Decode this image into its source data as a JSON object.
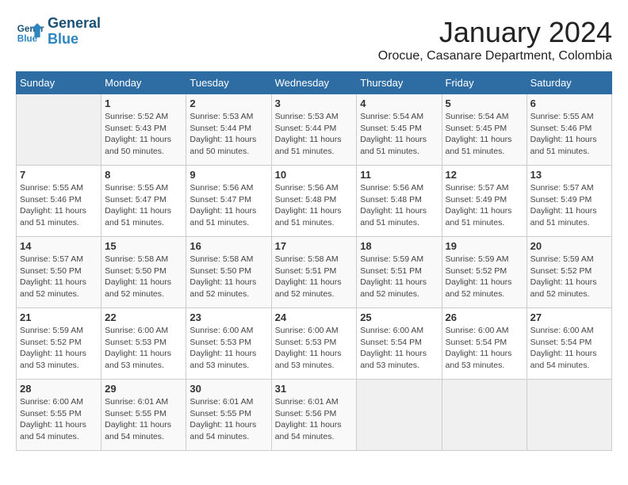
{
  "logo": {
    "text_line1": "General",
    "text_line2": "Blue"
  },
  "title": "January 2024",
  "location": "Orocue, Casanare Department, Colombia",
  "days_of_week": [
    "Sunday",
    "Monday",
    "Tuesday",
    "Wednesday",
    "Thursday",
    "Friday",
    "Saturday"
  ],
  "weeks": [
    [
      {
        "day": "",
        "sunrise": "",
        "sunset": "",
        "daylight": ""
      },
      {
        "day": "1",
        "sunrise": "5:52 AM",
        "sunset": "5:43 PM",
        "daylight": "11 hours and 50 minutes."
      },
      {
        "day": "2",
        "sunrise": "5:53 AM",
        "sunset": "5:44 PM",
        "daylight": "11 hours and 50 minutes."
      },
      {
        "day": "3",
        "sunrise": "5:53 AM",
        "sunset": "5:44 PM",
        "daylight": "11 hours and 51 minutes."
      },
      {
        "day": "4",
        "sunrise": "5:54 AM",
        "sunset": "5:45 PM",
        "daylight": "11 hours and 51 minutes."
      },
      {
        "day": "5",
        "sunrise": "5:54 AM",
        "sunset": "5:45 PM",
        "daylight": "11 hours and 51 minutes."
      },
      {
        "day": "6",
        "sunrise": "5:55 AM",
        "sunset": "5:46 PM",
        "daylight": "11 hours and 51 minutes."
      }
    ],
    [
      {
        "day": "7",
        "sunrise": "5:55 AM",
        "sunset": "5:46 PM",
        "daylight": "11 hours and 51 minutes."
      },
      {
        "day": "8",
        "sunrise": "5:55 AM",
        "sunset": "5:47 PM",
        "daylight": "11 hours and 51 minutes."
      },
      {
        "day": "9",
        "sunrise": "5:56 AM",
        "sunset": "5:47 PM",
        "daylight": "11 hours and 51 minutes."
      },
      {
        "day": "10",
        "sunrise": "5:56 AM",
        "sunset": "5:48 PM",
        "daylight": "11 hours and 51 minutes."
      },
      {
        "day": "11",
        "sunrise": "5:56 AM",
        "sunset": "5:48 PM",
        "daylight": "11 hours and 51 minutes."
      },
      {
        "day": "12",
        "sunrise": "5:57 AM",
        "sunset": "5:49 PM",
        "daylight": "11 hours and 51 minutes."
      },
      {
        "day": "13",
        "sunrise": "5:57 AM",
        "sunset": "5:49 PM",
        "daylight": "11 hours and 51 minutes."
      }
    ],
    [
      {
        "day": "14",
        "sunrise": "5:57 AM",
        "sunset": "5:50 PM",
        "daylight": "11 hours and 52 minutes."
      },
      {
        "day": "15",
        "sunrise": "5:58 AM",
        "sunset": "5:50 PM",
        "daylight": "11 hours and 52 minutes."
      },
      {
        "day": "16",
        "sunrise": "5:58 AM",
        "sunset": "5:50 PM",
        "daylight": "11 hours and 52 minutes."
      },
      {
        "day": "17",
        "sunrise": "5:58 AM",
        "sunset": "5:51 PM",
        "daylight": "11 hours and 52 minutes."
      },
      {
        "day": "18",
        "sunrise": "5:59 AM",
        "sunset": "5:51 PM",
        "daylight": "11 hours and 52 minutes."
      },
      {
        "day": "19",
        "sunrise": "5:59 AM",
        "sunset": "5:52 PM",
        "daylight": "11 hours and 52 minutes."
      },
      {
        "day": "20",
        "sunrise": "5:59 AM",
        "sunset": "5:52 PM",
        "daylight": "11 hours and 52 minutes."
      }
    ],
    [
      {
        "day": "21",
        "sunrise": "5:59 AM",
        "sunset": "5:52 PM",
        "daylight": "11 hours and 53 minutes."
      },
      {
        "day": "22",
        "sunrise": "6:00 AM",
        "sunset": "5:53 PM",
        "daylight": "11 hours and 53 minutes."
      },
      {
        "day": "23",
        "sunrise": "6:00 AM",
        "sunset": "5:53 PM",
        "daylight": "11 hours and 53 minutes."
      },
      {
        "day": "24",
        "sunrise": "6:00 AM",
        "sunset": "5:53 PM",
        "daylight": "11 hours and 53 minutes."
      },
      {
        "day": "25",
        "sunrise": "6:00 AM",
        "sunset": "5:54 PM",
        "daylight": "11 hours and 53 minutes."
      },
      {
        "day": "26",
        "sunrise": "6:00 AM",
        "sunset": "5:54 PM",
        "daylight": "11 hours and 53 minutes."
      },
      {
        "day": "27",
        "sunrise": "6:00 AM",
        "sunset": "5:54 PM",
        "daylight": "11 hours and 54 minutes."
      }
    ],
    [
      {
        "day": "28",
        "sunrise": "6:00 AM",
        "sunset": "5:55 PM",
        "daylight": "11 hours and 54 minutes."
      },
      {
        "day": "29",
        "sunrise": "6:01 AM",
        "sunset": "5:55 PM",
        "daylight": "11 hours and 54 minutes."
      },
      {
        "day": "30",
        "sunrise": "6:01 AM",
        "sunset": "5:55 PM",
        "daylight": "11 hours and 54 minutes."
      },
      {
        "day": "31",
        "sunrise": "6:01 AM",
        "sunset": "5:56 PM",
        "daylight": "11 hours and 54 minutes."
      },
      {
        "day": "",
        "sunrise": "",
        "sunset": "",
        "daylight": ""
      },
      {
        "day": "",
        "sunrise": "",
        "sunset": "",
        "daylight": ""
      },
      {
        "day": "",
        "sunrise": "",
        "sunset": "",
        "daylight": ""
      }
    ]
  ],
  "labels": {
    "sunrise": "Sunrise:",
    "sunset": "Sunset:",
    "daylight": "Daylight:"
  }
}
